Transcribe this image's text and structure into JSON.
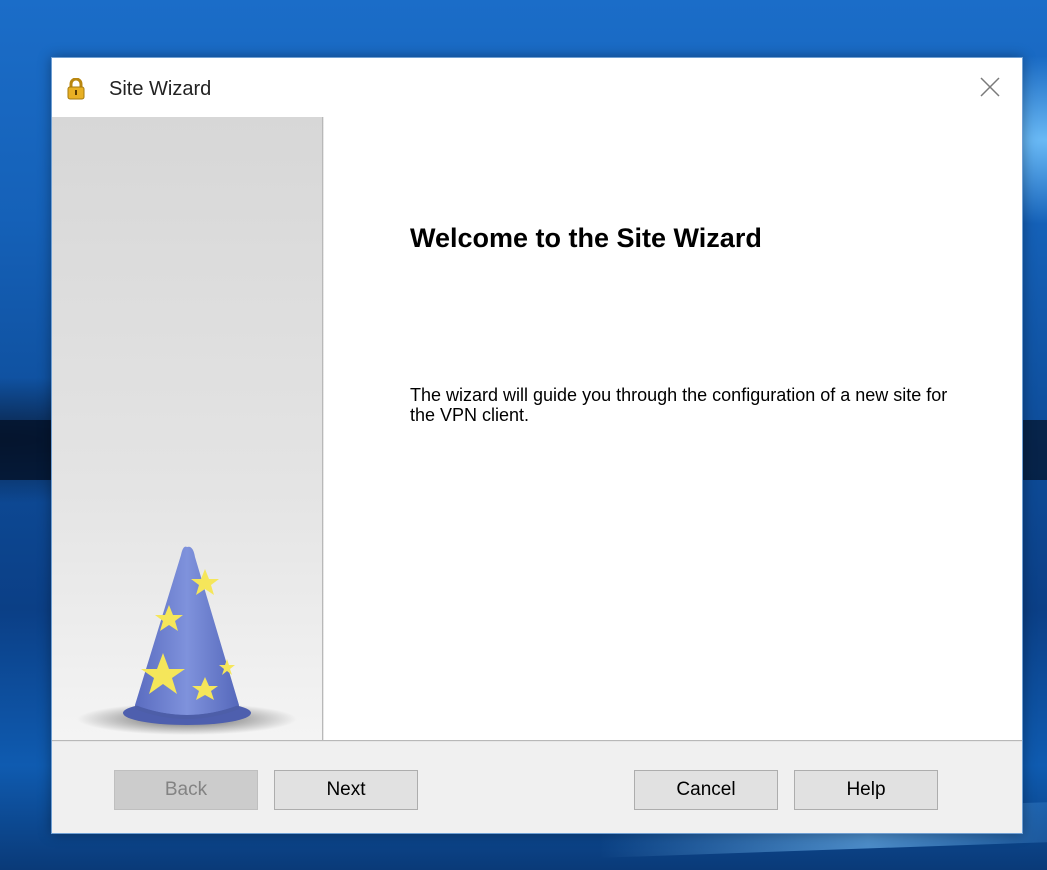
{
  "window": {
    "title": "Site Wizard"
  },
  "main": {
    "heading": "Welcome to the Site Wizard",
    "description": "The wizard will guide you through the configuration of a new site for the VPN client."
  },
  "buttons": {
    "back": "Back",
    "next": "Next",
    "cancel": "Cancel",
    "help": "Help"
  },
  "icons": {
    "title": "lock-icon",
    "close": "close-icon",
    "illustration": "wizard-hat-icon"
  },
  "colors": {
    "hat_blue": "#6f82cf",
    "stars_yellow": "#f5e65a",
    "lock_gold": "#e0a820"
  }
}
